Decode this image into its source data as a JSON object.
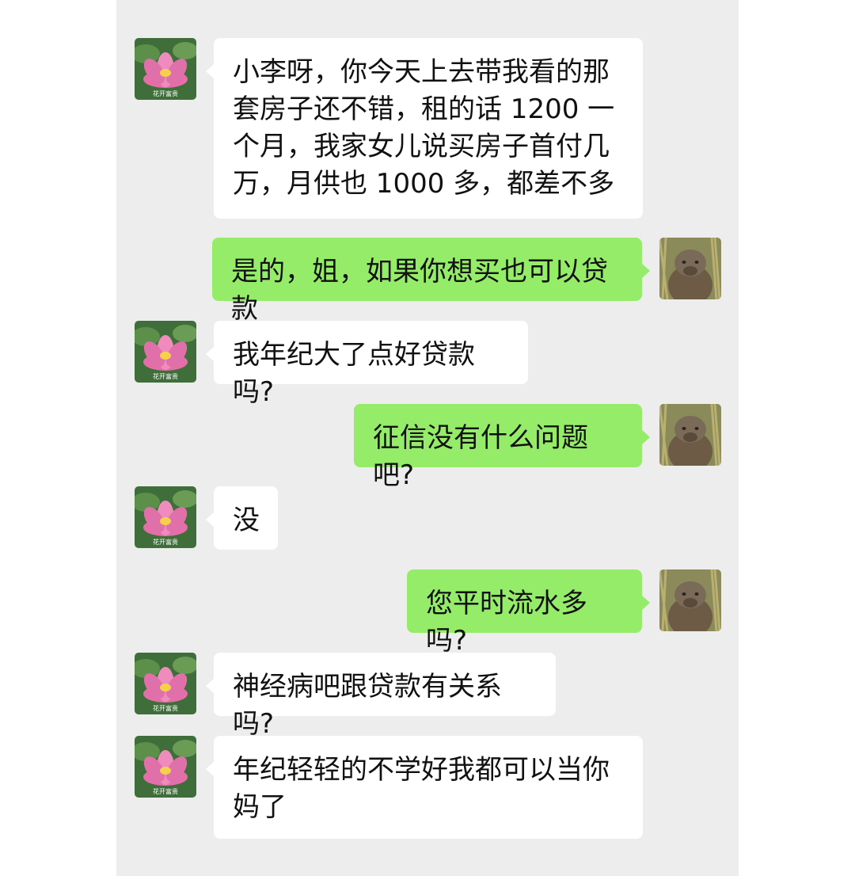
{
  "contact": {
    "avatar_caption": "花开富贵",
    "avatar_icon": "lotus-flower-icon"
  },
  "me": {
    "avatar_icon": "capybara-avatar-icon"
  },
  "messages": [
    {
      "from": "contact",
      "text": "小李呀，你今天上去带我看的那套房子还不错，租的话 1200 一个月，我家女儿说买房子首付几万，月供也 1000 多，都差不多"
    },
    {
      "from": "me",
      "text": "是的，姐，如果你想买也可以贷款"
    },
    {
      "from": "contact",
      "text": "我年纪大了点好贷款吗?"
    },
    {
      "from": "me",
      "text": "征信没有什么问题吧?"
    },
    {
      "from": "contact",
      "text": "没"
    },
    {
      "from": "me",
      "text": "您平时流水多吗?"
    },
    {
      "from": "contact",
      "text": "神经病吧跟贷款有关系吗?"
    },
    {
      "from": "contact",
      "text": "年纪轻轻的不学好我都可以当你妈了"
    }
  ],
  "colors": {
    "background": "#ededed",
    "incoming_bubble": "#ffffff",
    "outgoing_bubble": "#95ec69"
  }
}
